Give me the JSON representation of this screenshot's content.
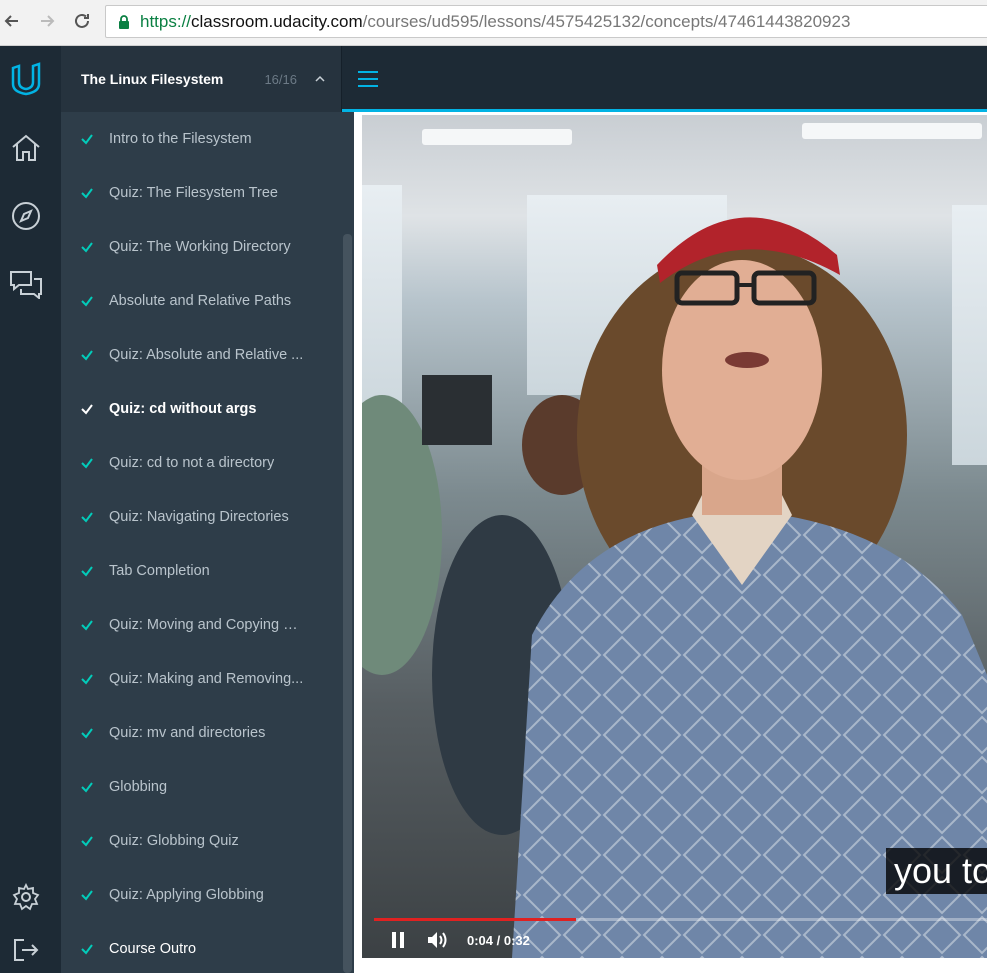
{
  "browser": {
    "url_protocol": "https://",
    "url_host": "classroom.udacity.com",
    "url_path": "/courses/ud595/lessons/4575425132/concepts/47461443820923"
  },
  "rail": {
    "icons": [
      "udacity-logo-icon",
      "home-icon",
      "compass-icon",
      "chat-icon",
      "gear-icon",
      "logout-icon"
    ]
  },
  "lesson": {
    "title": "The Linux Filesystem",
    "count": "16/16",
    "items": [
      {
        "label": "Intro to the Filesystem"
      },
      {
        "label": "Quiz: The Filesystem Tree"
      },
      {
        "label": "Quiz: The Working Directory"
      },
      {
        "label": "Absolute and Relative Paths"
      },
      {
        "label": "Quiz: Absolute and Relative ..."
      },
      {
        "label": "Quiz: cd without args"
      },
      {
        "label": "Quiz: cd to not a directory"
      },
      {
        "label": "Quiz: Navigating Directories"
      },
      {
        "label": "Tab Completion"
      },
      {
        "label": "Quiz: Moving and Copying Fi..."
      },
      {
        "label": "Quiz: Making and Removing..."
      },
      {
        "label": "Quiz: mv and directories"
      },
      {
        "label": "Globbing"
      },
      {
        "label": "Quiz: Globbing Quiz"
      },
      {
        "label": "Quiz: Applying Globbing"
      },
      {
        "label": "Course Outro"
      }
    ],
    "active_index": 5
  },
  "video": {
    "caption": "you to",
    "time": "0:04 / 0:32",
    "progress": 0.33
  },
  "colors": {
    "accent": "#02b3e4",
    "check": "#02ccba",
    "progress": "#e02121"
  }
}
